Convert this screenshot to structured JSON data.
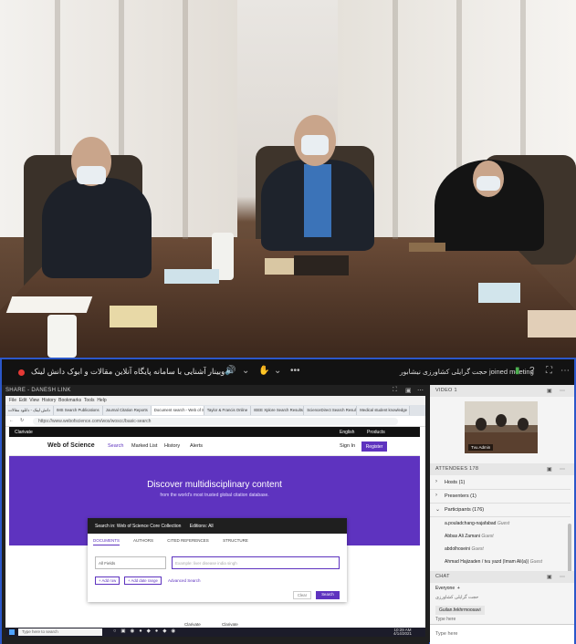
{
  "meeting": {
    "title": "وبینار آشنایی با سامانه پایگاه آنلاین مقالات و ابوک دانش لینک",
    "joined_text": "حجت گرایلی کشاورزی نیشابور joined meeting",
    "share_label": "SHARE - DANESH LINK",
    "accent": "#2b57c9"
  },
  "browser": {
    "menu": [
      "File",
      "Edit",
      "View",
      "History",
      "Bookmarks",
      "Tools",
      "Help"
    ],
    "tabs": [
      "دانش لینک - دانلود مقالات",
      "IMS Search Publications",
      "Journal Citation Reports",
      "Document search - Web of Science",
      "Taylor & Francis Online",
      "IEEE Xplore Search Results",
      "ScienceDirect Search Results",
      "Medical student knowledge"
    ],
    "url": "https://www.webofscience.com/wos/woscc/basic-search"
  },
  "wos": {
    "clarivate": "Clarivate",
    "english": "English",
    "products": "Products",
    "brand": "Web of Science",
    "nav": [
      "Search",
      "Marked List",
      "History",
      "Alerts"
    ],
    "signin": "Sign In",
    "register": "Register",
    "hero_title": "Discover multidisciplinary content",
    "hero_sub": "from the world's most trusted global citation database.",
    "search_in": "Search in: Web of Science Core Collection",
    "editions": "Editions: All",
    "search_tabs": [
      "DOCUMENTS",
      "AUTHORS",
      "CITED REFERENCES",
      "STRUCTURE"
    ],
    "field": "All Fields",
    "query_placeholder": "Example: liver disease india singh",
    "add_row": "+ Add row",
    "add_date": "+ Add date range",
    "advanced": "Advanced Search",
    "clear": "Clear",
    "search": "Search",
    "footer_logos": [
      "Clarivate",
      "Clarivate"
    ]
  },
  "taskbar": {
    "search_placeholder": "Type here to search",
    "time": "10:29 AM",
    "date": "4/14/2021"
  },
  "video_panel": {
    "label": "VIDEO",
    "count": "1",
    "tile_name": "Tvu Admin"
  },
  "attendees": {
    "label": "ATTENDEES",
    "count": "178",
    "groups": [
      "Hosts (1)",
      "Presenters (1)",
      "Participants (176)"
    ],
    "people": [
      {
        "name": "a.pouladchang-najafabad",
        "role": "Guest"
      },
      {
        "name": "Abbas Ali Zamani",
        "role": "Guest"
      },
      {
        "name": "abdolhoseini",
        "role": "Guest"
      },
      {
        "name": "Ahmad Hajizaden / tvu yazd (Imam Ali(a))",
        "role": "Guest"
      }
    ]
  },
  "chat": {
    "label": "CHAT",
    "everyone": "Everyone",
    "messages": [
      "حجت گرایلی کشاورزی",
      "Guilan.fekhrmoosavi",
      "Type here"
    ],
    "typebox": "Type here"
  }
}
